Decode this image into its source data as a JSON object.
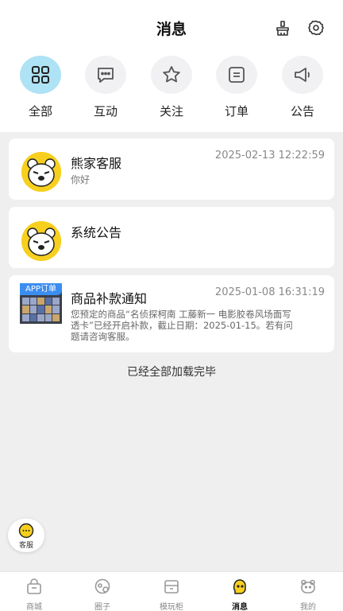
{
  "header": {
    "title": "消息",
    "icons": [
      "broom-icon",
      "gear-icon"
    ]
  },
  "categories": [
    {
      "label": "全部",
      "icon": "grid-icon",
      "active": true
    },
    {
      "label": "互动",
      "icon": "chat-bubble-icon",
      "active": false
    },
    {
      "label": "关注",
      "icon": "star-icon",
      "active": false
    },
    {
      "label": "订单",
      "icon": "order-icon",
      "active": false
    },
    {
      "label": "公告",
      "icon": "megaphone-icon",
      "active": false
    }
  ],
  "messages": [
    {
      "name": "熊家客服",
      "time": "2025-02-13 12:22:59",
      "preview": "你好"
    },
    {
      "name": "系统公告",
      "time": "",
      "preview": ""
    },
    {
      "name": "商品补款通知",
      "time": "2025-01-08 16:31:19",
      "badge": "APP订单",
      "desc_line1": "您预定的商品“名侦探柯南 工藤新一 电影胶卷风场面写",
      "desc_line2": "透卡”已经开启补款，截止日期：2025-01-15。若有问",
      "desc_line3": "题请咨询客服。"
    }
  ],
  "footer_text": "已经全部加载完毕",
  "service": {
    "label": "客服"
  },
  "tabbar": [
    {
      "label": "商城",
      "icon": "shop-icon",
      "active": false
    },
    {
      "label": "圈子",
      "icon": "circle-icon",
      "active": false
    },
    {
      "label": "模玩柜",
      "icon": "cabinet-icon",
      "active": false
    },
    {
      "label": "消息",
      "icon": "message-icon",
      "active": true
    },
    {
      "label": "我的",
      "icon": "bear-face-icon",
      "active": false
    }
  ],
  "colors": {
    "accent_bg": "#aee2f5",
    "avatar_yellow": "#f7cf1e",
    "badge_blue": "#3b8ef0"
  }
}
